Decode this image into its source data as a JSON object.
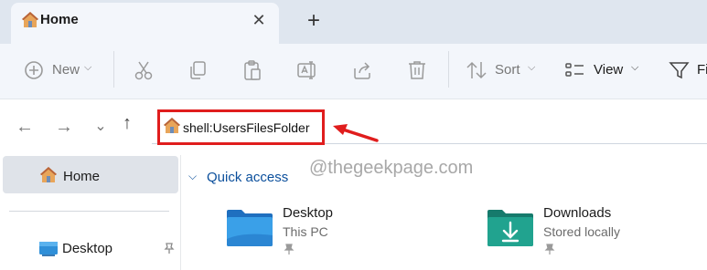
{
  "tab": {
    "title": "Home",
    "close_glyph": "✕",
    "new_tab_glyph": "+"
  },
  "toolbar": {
    "new_label": "New",
    "sort_label": "Sort",
    "view_label": "View",
    "filter_label": "Fi",
    "icons": [
      "plus-circle-icon",
      "cut-icon",
      "copy-icon",
      "paste-icon",
      "rename-icon",
      "share-icon",
      "delete-icon",
      "sort-icon",
      "view-icon",
      "filter-icon"
    ]
  },
  "nav": {
    "back_glyph": "←",
    "forward_glyph": "→",
    "recent_glyph": "⌄",
    "up_glyph": "↑",
    "address_value": "shell:UsersFilesFolder"
  },
  "sidebar": {
    "items": [
      {
        "label": "Home",
        "icon": "home-icon",
        "selected": true
      },
      {
        "label": "Desktop",
        "icon": "desktop-icon",
        "pinned": true
      }
    ]
  },
  "main": {
    "section_label": "Quick access",
    "watermark": "@thegeekpage.com",
    "items": [
      {
        "name": "Desktop",
        "subtitle": "This PC",
        "icon": "desktop-folder-icon",
        "pinned": true
      },
      {
        "name": "Downloads",
        "subtitle": "Stored locally",
        "icon": "downloads-folder-icon",
        "pinned": true
      }
    ]
  },
  "colors": {
    "tabstrip": "#dfe6ef",
    "toolbar": "#f3f6fb",
    "highlight": "#e01d1d",
    "accent": "#0b4f9c"
  }
}
